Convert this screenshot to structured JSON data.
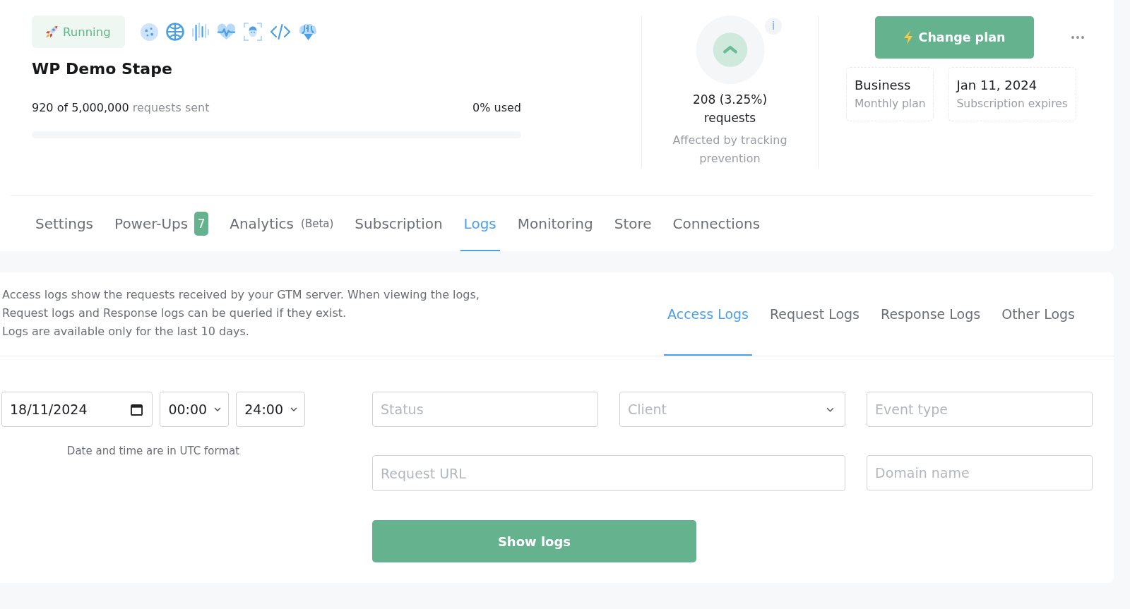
{
  "status_badge": {
    "label": "Running"
  },
  "container": {
    "title": "WP Demo Stape",
    "usage": {
      "sent": "920 of 5,000,000",
      "unit": "requests sent",
      "percent_used": "0% used",
      "level": 0
    }
  },
  "tracking_prevention": {
    "info": "i",
    "count": "208 (3.25%)",
    "unit": "requests",
    "caption": "Affected by tracking prevention"
  },
  "plan": {
    "change_button": "Change plan",
    "cards": [
      {
        "value": "Business",
        "caption": "Monthly plan"
      },
      {
        "value": "Jan 11, 2024",
        "caption": "Subscription expires"
      }
    ]
  },
  "tabs": [
    {
      "label": "Settings",
      "selected": false
    },
    {
      "label": "Power-Ups",
      "badge": "7",
      "selected": false
    },
    {
      "label": "Analytics",
      "note": "(Beta)",
      "selected": false
    },
    {
      "label": "Subscription",
      "selected": false
    },
    {
      "label": "Logs",
      "selected": true
    },
    {
      "label": "Monitoring",
      "selected": false
    },
    {
      "label": "Store",
      "selected": false
    },
    {
      "label": "Connections",
      "selected": false
    }
  ],
  "logs": {
    "description": "Access logs show the requests received by your GTM server. When viewing the logs, Request logs and Response logs can be queried if they exist.",
    "availability": "Logs are available only for the last 10 days.",
    "tabs": [
      {
        "label": "Access Logs",
        "selected": true
      },
      {
        "label": "Request Logs",
        "selected": false
      },
      {
        "label": "Response Logs",
        "selected": false
      },
      {
        "label": "Other Logs",
        "selected": false
      }
    ],
    "filters": {
      "date": {
        "value": "18/11/2024"
      },
      "start_time": {
        "value": "00:00"
      },
      "end_time": {
        "value": "24:00"
      },
      "timezone_note": "Date and time are in UTC format",
      "status": {
        "placeholder": "Status"
      },
      "client": {
        "placeholder": "Client"
      },
      "event_type": {
        "placeholder": "Event type"
      },
      "request_url": {
        "placeholder": "Request URL"
      },
      "domain_name": {
        "placeholder": "Domain name"
      }
    },
    "show_button": "Show logs"
  }
}
